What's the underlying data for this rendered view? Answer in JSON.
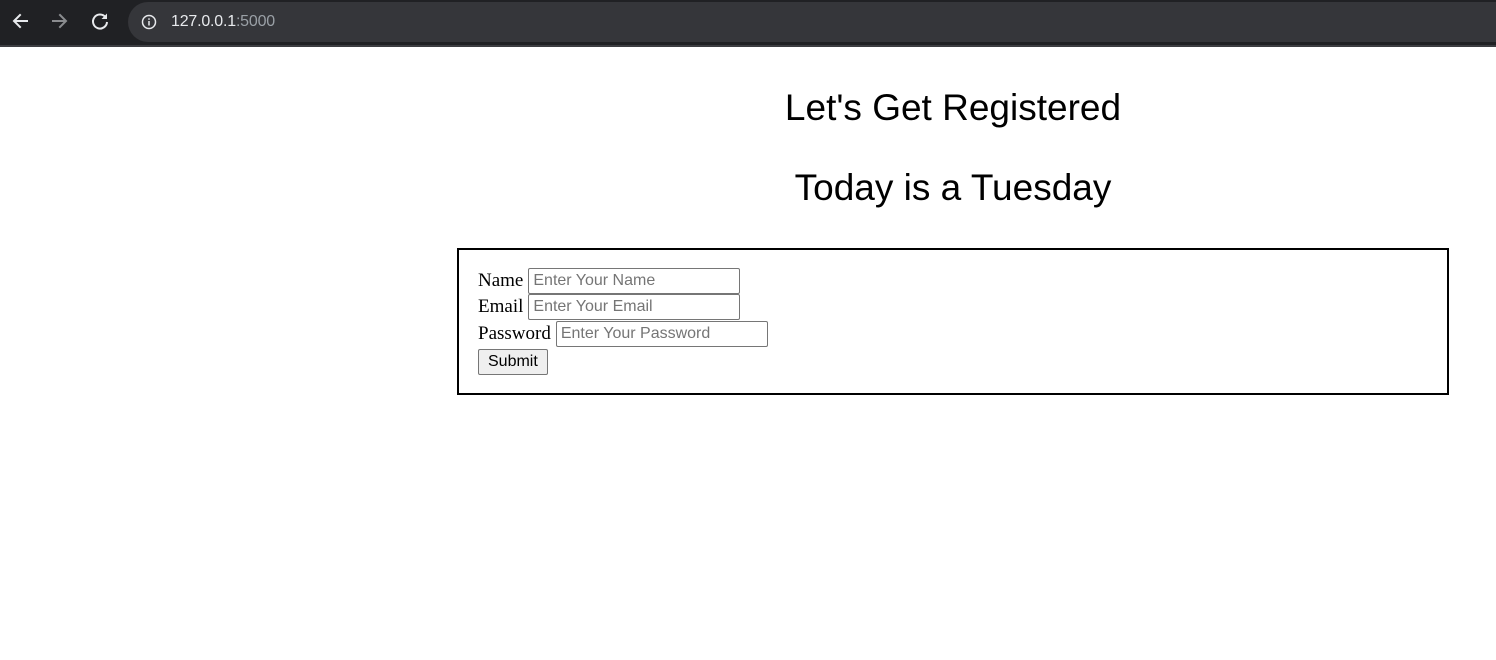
{
  "browser": {
    "url_host": "127.0.0.1",
    "url_port": ":5000",
    "icons": [
      "back-arrow-icon",
      "forward-arrow-icon",
      "reload-icon",
      "info-icon"
    ]
  },
  "page": {
    "heading": "Let's Get Registered",
    "subheading": "Today is a Tuesday"
  },
  "form": {
    "name_label": "Name",
    "name_placeholder": "Enter Your Name",
    "name_value": "",
    "email_label": "Email",
    "email_placeholder": "Enter Your Email",
    "email_value": "",
    "password_label": "Password",
    "password_placeholder": "Enter Your Password",
    "password_value": "",
    "submit_label": "Submit"
  }
}
